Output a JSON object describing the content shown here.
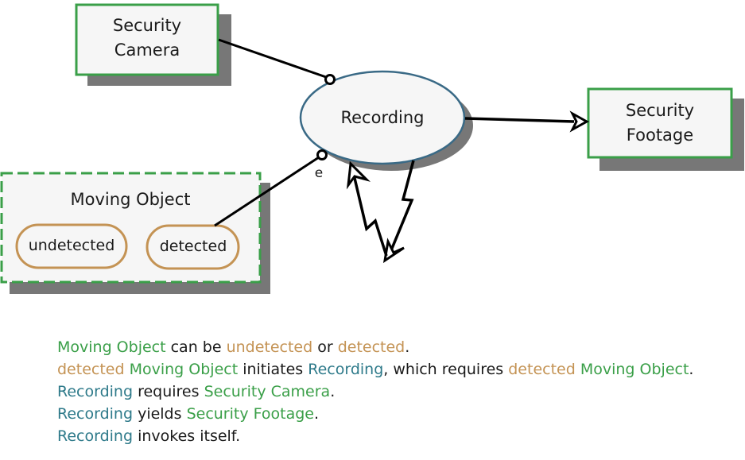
{
  "colors": {
    "object": "#3a9f48",
    "state": "#c49354",
    "process": "#2e7a8a",
    "process_border": "#3a6a86",
    "shadow": "#777777",
    "fill": "#f6f6f6",
    "link": "#000000"
  },
  "nodes": {
    "security_camera": {
      "line1": "Security",
      "line2": "Camera"
    },
    "recording": {
      "label": "Recording"
    },
    "security_footage": {
      "line1": "Security",
      "line2": "Footage"
    },
    "moving_object": {
      "label": "Moving Object",
      "states": [
        {
          "label": "undetected"
        },
        {
          "label": "detected"
        }
      ]
    }
  },
  "links": {
    "event_label": "e"
  },
  "opl": [
    [
      {
        "t": "Moving Object",
        "k": "obj"
      },
      {
        "t": " can be ",
        "k": ""
      },
      {
        "t": "undetected",
        "k": "state"
      },
      {
        "t": " or ",
        "k": ""
      },
      {
        "t": "detected",
        "k": "state"
      },
      {
        "t": ".",
        "k": ""
      }
    ],
    [
      {
        "t": "detected",
        "k": "state"
      },
      {
        "t": " ",
        "k": ""
      },
      {
        "t": "Moving Object",
        "k": "obj"
      },
      {
        "t": " initiates ",
        "k": ""
      },
      {
        "t": "Recording",
        "k": "proc"
      },
      {
        "t": ", which requires ",
        "k": ""
      },
      {
        "t": "detected",
        "k": "state"
      },
      {
        "t": " ",
        "k": ""
      },
      {
        "t": "Moving Object",
        "k": "obj"
      },
      {
        "t": ".",
        "k": ""
      }
    ],
    [
      {
        "t": "Recording",
        "k": "proc"
      },
      {
        "t": " requires ",
        "k": ""
      },
      {
        "t": "Security Camera",
        "k": "obj"
      },
      {
        "t": ".",
        "k": ""
      }
    ],
    [
      {
        "t": "Recording",
        "k": "proc"
      },
      {
        "t": " yields ",
        "k": ""
      },
      {
        "t": "Security Footage",
        "k": "obj"
      },
      {
        "t": ".",
        "k": ""
      }
    ],
    [
      {
        "t": "Recording",
        "k": "proc"
      },
      {
        "t": " invokes itself.",
        "k": ""
      }
    ]
  ]
}
